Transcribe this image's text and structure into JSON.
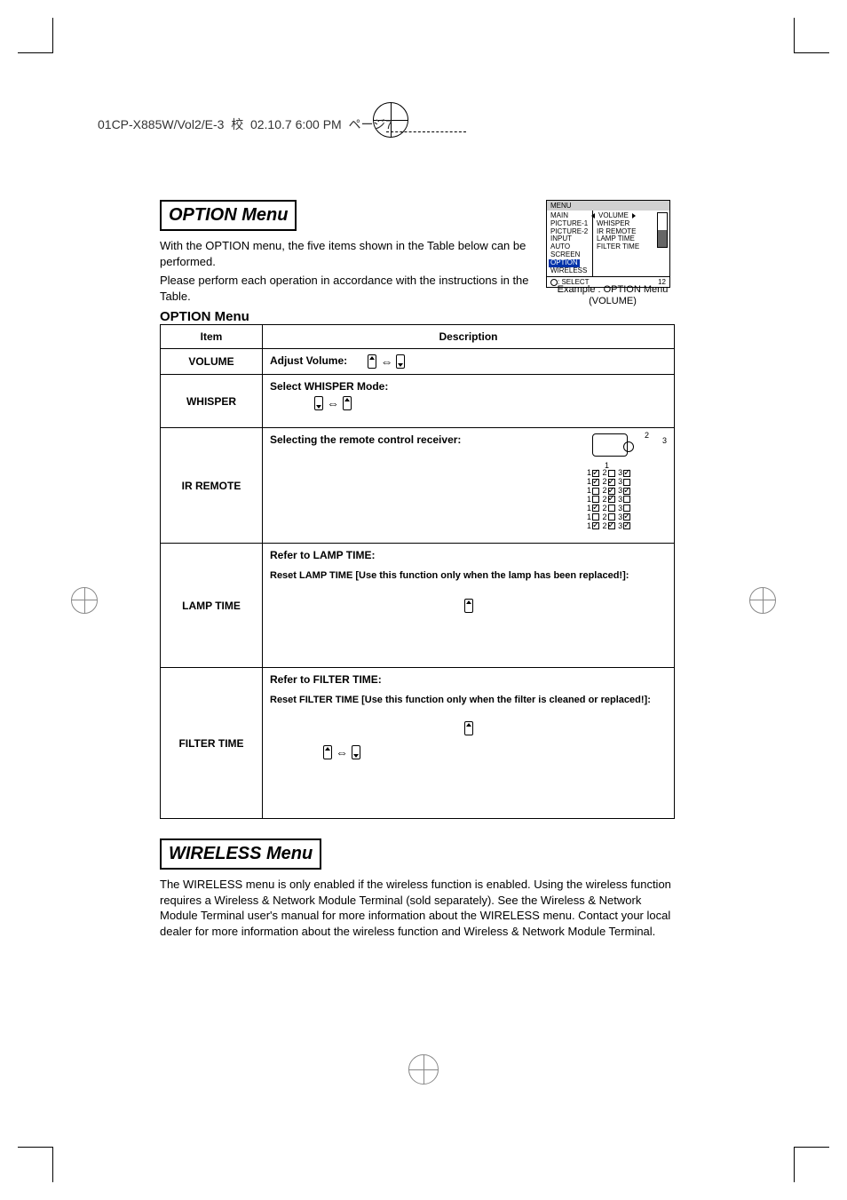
{
  "header": {
    "filename": "01CP-X885W/Vol2/E-3",
    "proof": "校",
    "datetime": "02.10.7 6:00 PM",
    "pagemark": "ページ7"
  },
  "option_section": {
    "title": "OPTION Menu",
    "intro_1": "With the OPTION menu, the five items shown in the Table below can be performed.",
    "intro_2": "Please perform each operation in accordance with the instructions in the Table.",
    "table_title": "OPTION Menu"
  },
  "osd": {
    "menu_label": "MENU",
    "left_items": [
      "MAIN",
      "PICTURE-1",
      "PICTURE-2",
      "INPUT",
      "AUTO",
      "SCREEN",
      "OPTION",
      "WIRELESS"
    ],
    "selected_left": "OPTION",
    "right_items": [
      "VOLUME",
      "WHISPER",
      "IR REMOTE",
      "LAMP TIME",
      "FILTER TIME"
    ],
    "selected_right": "VOLUME",
    "footer_left": ": SELECT",
    "footer_right": "12",
    "caption_line1": "Example : OPTION Menu",
    "caption_line2": "(VOLUME)"
  },
  "table": {
    "head_item": "Item",
    "head_desc": "Description",
    "rows": [
      {
        "item": "VOLUME",
        "title": "Adjust Volume:"
      },
      {
        "item": "WHISPER",
        "title": "Select WHISPER Mode:"
      },
      {
        "item": "IR REMOTE",
        "title": "Selecting the remote control receiver:",
        "diagram_labels": [
          "1",
          "2",
          "3"
        ],
        "checkbox_rows": [
          [
            true,
            false,
            true
          ],
          [
            true,
            true,
            false
          ],
          [
            false,
            true,
            true
          ],
          [
            false,
            true,
            false
          ],
          [
            true,
            false,
            false
          ],
          [
            false,
            false,
            true
          ],
          [
            true,
            true,
            true
          ]
        ]
      },
      {
        "item": "LAMP TIME",
        "title": "Refer to LAMP TIME:",
        "sub": "Reset LAMP TIME  [Use this function only when the lamp has been replaced!]:"
      },
      {
        "item": "FILTER TIME",
        "title": "Refer to FILTER TIME:",
        "sub": "Reset FILTER TIME [Use this function only when the filter is cleaned or replaced!]:"
      }
    ]
  },
  "wireless_section": {
    "title": "WIRELESS Menu",
    "body": "The WIRELESS menu is only enabled if the wireless function is enabled. Using the wireless function requires a Wireless & Network Module Terminal (sold separately). See the Wireless & Network Module Terminal user's manual for more information about the WIRELESS menu. Contact your local dealer for more information about the wireless function and Wireless & Network Module Terminal."
  }
}
